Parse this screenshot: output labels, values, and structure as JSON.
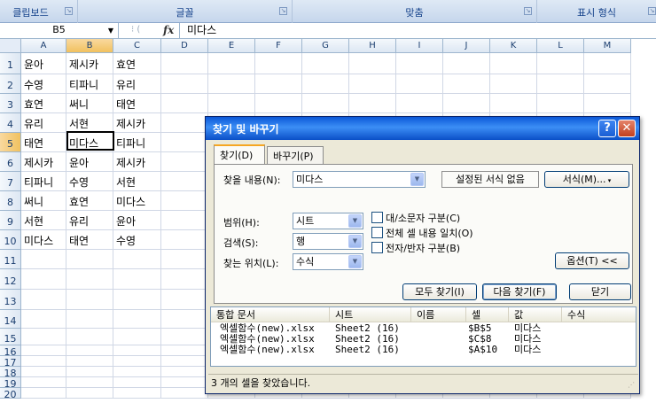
{
  "ribbon": {
    "groups": [
      {
        "label": "클립보드"
      },
      {
        "label": "글꼴"
      },
      {
        "label": "맞춤"
      },
      {
        "label": "표시 형식"
      }
    ]
  },
  "formula_bar": {
    "name_box": "B5",
    "formula_icon": "fx",
    "content": "미다스"
  },
  "sheet": {
    "columns": [
      "A",
      "B",
      "C",
      "D",
      "E",
      "F",
      "G",
      "H",
      "I",
      "J",
      "K",
      "L",
      "M"
    ],
    "selected_column": "B",
    "rows": [
      "1",
      "2",
      "3",
      "4",
      "5",
      "6",
      "7",
      "8",
      "9",
      "10",
      "11",
      "12",
      "13",
      "14",
      "15",
      "16",
      "17",
      "18",
      "19",
      "20"
    ],
    "selected_row": "5",
    "data": [
      [
        "윤아",
        "제시카",
        "효연"
      ],
      [
        "수영",
        "티파니",
        "유리"
      ],
      [
        "효연",
        "써니",
        "태연"
      ],
      [
        "유리",
        "서현",
        "제시카"
      ],
      [
        "태연",
        "미다스",
        "티파니"
      ],
      [
        "제시카",
        "윤아",
        "제시카"
      ],
      [
        "티파니",
        "수영",
        "서현"
      ],
      [
        "써니",
        "효연",
        "미다스"
      ],
      [
        "서현",
        "유리",
        "윤아"
      ],
      [
        "미다스",
        "태연",
        "수영"
      ]
    ]
  },
  "dialog": {
    "title": "찾기 및 바꾸기",
    "tabs": [
      {
        "label": "찾기(D)"
      },
      {
        "label": "바꾸기(P)"
      }
    ],
    "find_label": "찾을 내용(N):",
    "find_value": "미다스",
    "format_preview": "설정된 서식 없음",
    "format_button": "서식(M)...",
    "within_label": "범위(H):",
    "within_value": "시트",
    "search_label": "검색(S):",
    "search_value": "행",
    "lookin_label": "찾는 위치(L):",
    "lookin_value": "수식",
    "match_case": "대/소문자 구분(C)",
    "match_entire": "전체 셀 내용 일치(O)",
    "match_byte": "전자/반자 구분(B)",
    "options_button": "옵션(T) <<",
    "find_all_button": "모두 찾기(I)",
    "find_next_button": "다음 찾기(F)",
    "close_button": "닫기",
    "results_headers": [
      "통합 문서",
      "시트",
      "이름",
      "셀",
      "값",
      "수식"
    ],
    "results": [
      {
        "book": "엑셀함수(new).xlsx",
        "sheet": "Sheet2 (16)",
        "name": "",
        "cell": "$B$5",
        "value": "미다스",
        "formula": ""
      },
      {
        "book": "엑셀함수(new).xlsx",
        "sheet": "Sheet2 (16)",
        "name": "",
        "cell": "$C$8",
        "value": "미다스",
        "formula": ""
      },
      {
        "book": "엑셀함수(new).xlsx",
        "sheet": "Sheet2 (16)",
        "name": "",
        "cell": "$A$10",
        "value": "미다스",
        "formula": ""
      }
    ],
    "status": "3 개의 셀을 찾았습니다."
  }
}
